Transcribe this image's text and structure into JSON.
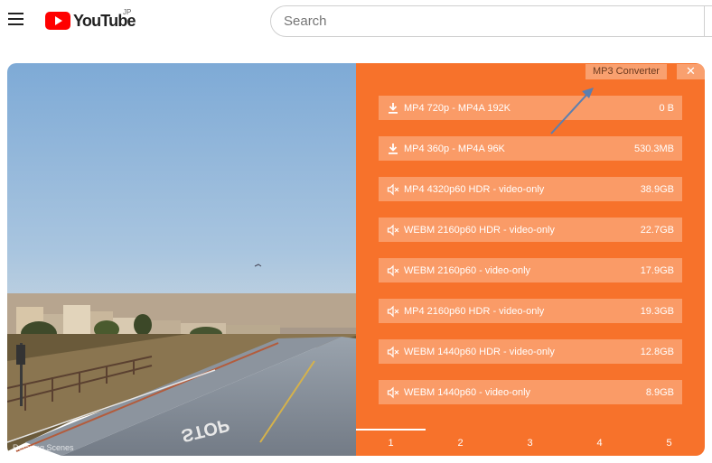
{
  "header": {
    "logo_text": "YouTube",
    "region": "JP",
    "search_placeholder": "Search"
  },
  "video": {
    "watermark": "Relaxing Scenes",
    "road_text": "STOP"
  },
  "panel": {
    "mp3_label": "MP3 Converter",
    "close_glyph": "✕",
    "formats": [
      {
        "label": "MP4 720p - MP4A 192K",
        "size": "0 B",
        "icon": "download-icon"
      },
      {
        "label": "MP4 360p - MP4A 96K",
        "size": "530.3MB",
        "icon": "download-icon"
      },
      {
        "label": "MP4 4320p60 HDR - video-only",
        "size": "38.9GB",
        "icon": "mute-icon"
      },
      {
        "label": "WEBM 2160p60 HDR - video-only",
        "size": "22.7GB",
        "icon": "mute-icon"
      },
      {
        "label": "WEBM 2160p60 - video-only",
        "size": "17.9GB",
        "icon": "mute-icon"
      },
      {
        "label": "MP4 2160p60 HDR - video-only",
        "size": "19.3GB",
        "icon": "mute-icon"
      },
      {
        "label": "WEBM 1440p60 HDR - video-only",
        "size": "12.8GB",
        "icon": "mute-icon"
      },
      {
        "label": "WEBM 1440p60 - video-only",
        "size": "8.9GB",
        "icon": "mute-icon"
      }
    ],
    "pages": [
      "1",
      "2",
      "3",
      "4",
      "5"
    ],
    "active_page": 1
  },
  "colors": {
    "panel_bg": "#f7722b",
    "item_bg": "#fa9b67",
    "logo_red": "#ff0000"
  }
}
